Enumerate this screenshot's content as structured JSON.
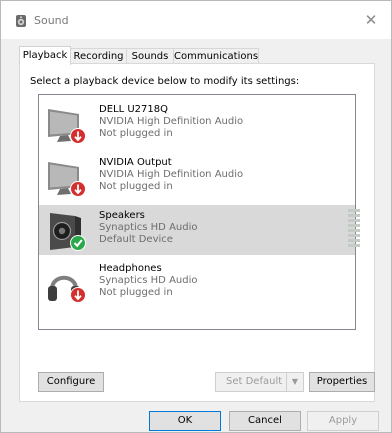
{
  "window": {
    "title": "Sound",
    "close_glyph": "✕",
    "icon": "speaker-icon"
  },
  "tabs": [
    {
      "label": "Playback",
      "active": true
    },
    {
      "label": "Recording",
      "active": false
    },
    {
      "label": "Sounds",
      "active": false
    },
    {
      "label": "Communications",
      "active": false
    }
  ],
  "instruction": "Select a playback device below to modify its settings:",
  "devices": [
    {
      "name": "DELL U2718Q",
      "driver": "NVIDIA High Definition Audio",
      "status": "Not plugged in",
      "icon": "monitor-icon",
      "badge": "unplugged-badge-icon",
      "selected": false
    },
    {
      "name": "NVIDIA Output",
      "driver": "NVIDIA High Definition Audio",
      "status": "Not plugged in",
      "icon": "monitor-icon",
      "badge": "unplugged-badge-icon",
      "selected": false
    },
    {
      "name": "Speakers",
      "driver": "Synaptics HD Audio",
      "status": "Default Device",
      "icon": "speakers-icon",
      "badge": "default-check-icon",
      "selected": true
    },
    {
      "name": "Headphones",
      "driver": "Synaptics HD Audio",
      "status": "Not plugged in",
      "icon": "headphones-icon",
      "badge": "unplugged-badge-icon",
      "selected": false
    }
  ],
  "buttons": {
    "configure": "Configure",
    "set_default": "Set Default",
    "set_default_arrow": "▼",
    "properties": "Properties",
    "ok": "OK",
    "cancel": "Cancel",
    "apply": "Apply"
  },
  "colors": {
    "unplugged_badge": "#d32f2f",
    "default_badge": "#2ba84a",
    "selected_row": "#d9d9d9"
  }
}
